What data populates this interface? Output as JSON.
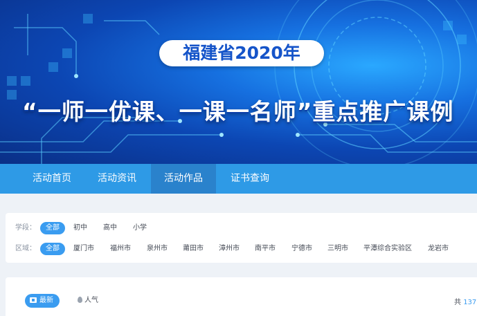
{
  "banner": {
    "title_pill": "福建省2020年",
    "main_title": "“一师一优课、一课一名师”重点推广课例"
  },
  "nav": {
    "items": [
      "活动首页",
      "活动资讯",
      "活动作品",
      "证书查询"
    ],
    "active_index": 2
  },
  "filters": {
    "stage": {
      "label": "学段：",
      "options": [
        "全部",
        "初中",
        "高中",
        "小学"
      ],
      "selected": "全部"
    },
    "region": {
      "label": "区域：",
      "options": [
        "全部",
        "厦门市",
        "福州市",
        "泉州市",
        "莆田市",
        "漳州市",
        "南平市",
        "宁德市",
        "三明市",
        "平潭综合实验区",
        "龙岩市"
      ],
      "selected": "全部"
    }
  },
  "results": {
    "sort_newest": "最新",
    "sort_popular": "人气",
    "total_prefix": "共",
    "total_count": "137"
  },
  "colors": {
    "nav_bg": "#2e9ae6",
    "nav_active": "#2a82cc",
    "accent": "#3a9cf0",
    "banner_dark": "#0a2f86"
  }
}
